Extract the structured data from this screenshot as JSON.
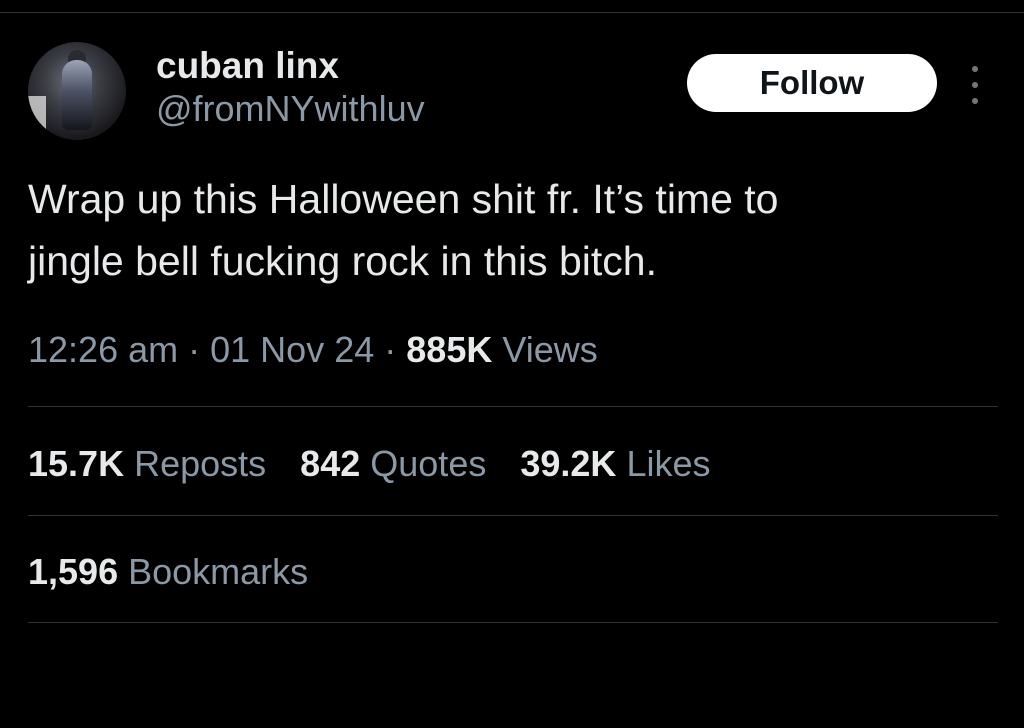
{
  "tweet": {
    "author": {
      "display_name": "cuban linx",
      "handle": "@fromNYwithluv"
    },
    "follow_label": "Follow",
    "more_icon": "more-vertical-icon",
    "text_line_1": "Wrap up this Halloween shit fr. It’s time to",
    "text_line_2": "jingle bell fucking rock in this bitch.",
    "time": "12:26 am",
    "date": "01 Nov 24",
    "views_count": "885K",
    "views_label": "Views",
    "separator": "·"
  },
  "engagement": {
    "reposts_count": "15.7K",
    "reposts_label": "Reposts",
    "quotes_count": "842",
    "quotes_label": "Quotes",
    "likes_count": "39.2K",
    "likes_label": "Likes",
    "bookmarks_count": "1,596",
    "bookmarks_label": "Bookmarks"
  },
  "colors": {
    "background": "#000000",
    "primary_text": "#e7e9ea",
    "secondary_text": "#8b98a5",
    "divider": "#2f3336",
    "follow_button_bg": "#ffffff"
  }
}
